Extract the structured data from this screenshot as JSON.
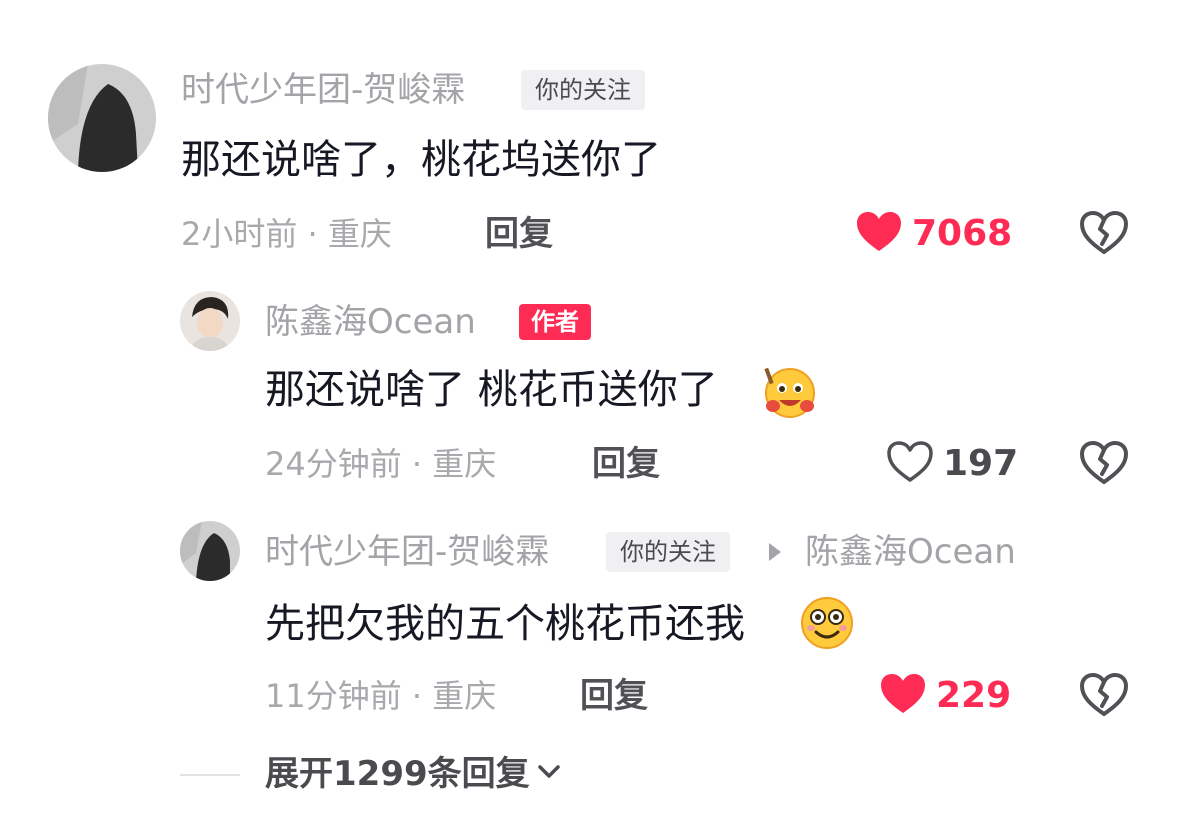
{
  "comments": [
    {
      "author": "时代少年团-贺峻霖",
      "badge": "你的关注",
      "text": "那还说啥了，桃花坞送你了",
      "time": "2小时前 · 重庆",
      "reply_label": "回复",
      "likes": "7068",
      "liked": true
    }
  ],
  "replies": [
    {
      "author": "陈鑫海Ocean",
      "badge": "作者",
      "text": "那还说啥了 桃花币送你了",
      "emoji": "hugging-face-emoji",
      "time": "24分钟前 · 重庆",
      "reply_label": "回复",
      "likes": "197",
      "liked": false
    },
    {
      "author": "时代少年团-贺峻霖",
      "badge": "你的关注",
      "reply_to": "陈鑫海Ocean",
      "text": "先把欠我的五个桃花币还我",
      "emoji": "smiling-face-emoji",
      "time": "11分钟前 · 重庆",
      "reply_label": "回复",
      "likes": "229",
      "liked": true
    }
  ],
  "expand_label": "展开1299条回复",
  "colors": {
    "accent": "#fe2c55",
    "muted": "#a3a3a8",
    "text": "#161823"
  },
  "icons": {
    "like_filled": "heart-filled-icon",
    "like_outline": "heart-outline-icon",
    "dislike": "broken-heart-icon",
    "arrow": "triangle-right-icon",
    "expand": "chevron-down-icon"
  }
}
